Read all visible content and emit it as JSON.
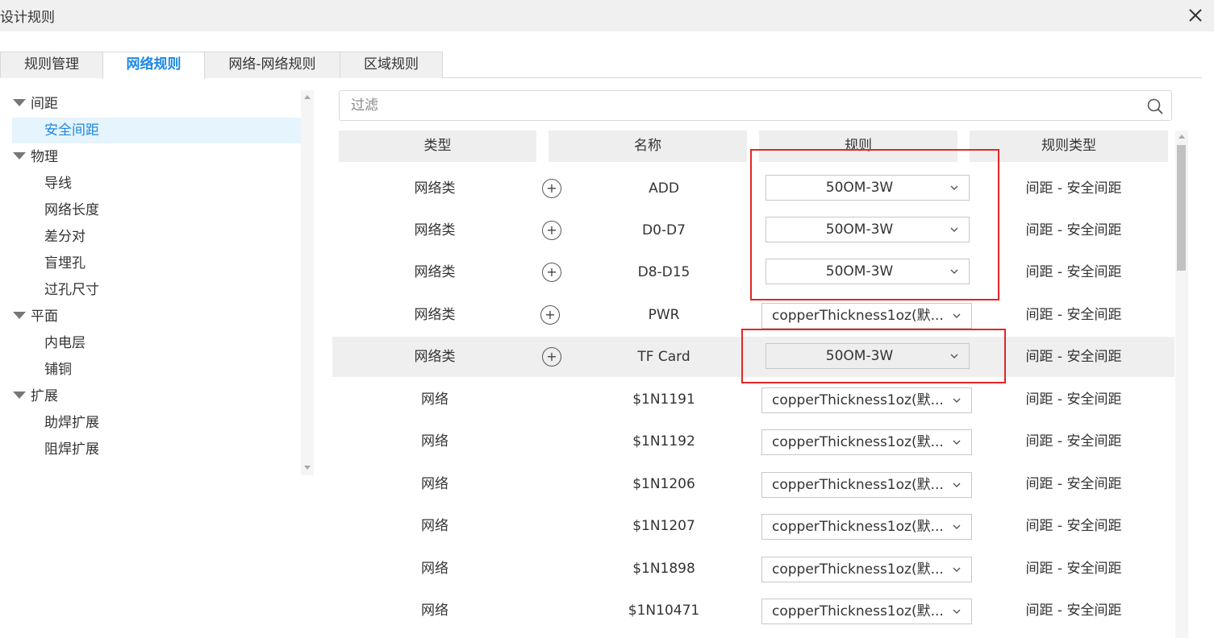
{
  "window": {
    "title": "设计规则"
  },
  "tabs": [
    {
      "label": "规则管理",
      "active": false
    },
    {
      "label": "网络规则",
      "active": true
    },
    {
      "label": "网络-网络规则",
      "active": false
    },
    {
      "label": "区域规则",
      "active": false
    }
  ],
  "tree": {
    "spacing": {
      "label": "间距",
      "children": [
        "安全间距"
      ]
    },
    "physical": {
      "label": "物理",
      "children": [
        "导线",
        "网络长度",
        "差分对",
        "盲埋孔",
        "过孔尺寸"
      ]
    },
    "plane": {
      "label": "平面",
      "children": [
        "内电层",
        "铺铜"
      ]
    },
    "expansion": {
      "label": "扩展",
      "children": [
        "助焊扩展",
        "阻焊扩展"
      ]
    },
    "selected": "安全间距"
  },
  "filter": {
    "placeholder": "过滤",
    "value": ""
  },
  "table": {
    "headers": {
      "type": "类型",
      "name": "名称",
      "rule": "规则",
      "rule_type": "规则类型"
    },
    "plus_symbol": "+",
    "rows": [
      {
        "type": "网络类",
        "name": "ADD",
        "rule": "50OM-3W",
        "rule_type": "间距 - 安全间距"
      },
      {
        "type": "网络类",
        "name": "D0-D7",
        "rule": "50OM-3W",
        "rule_type": "间距 - 安全间距"
      },
      {
        "type": "网络类",
        "name": "D8-D15",
        "rule": "50OM-3W",
        "rule_type": "间距 - 安全间距"
      },
      {
        "type": "网络类",
        "name": "PWR",
        "rule": "copperThickness1oz(默...",
        "rule_type": "间距 - 安全间距"
      },
      {
        "type": "网络类",
        "name": "TF Card",
        "rule": "50OM-3W",
        "rule_type": "间距 - 安全间距",
        "highlighted": true
      },
      {
        "type": "网络",
        "name": "$1N1191",
        "rule": "copperThickness1oz(默...",
        "rule_type": "间距 - 安全间距"
      },
      {
        "type": "网络",
        "name": "$1N1192",
        "rule": "copperThickness1oz(默...",
        "rule_type": "间距 - 安全间距"
      },
      {
        "type": "网络",
        "name": "$1N1206",
        "rule": "copperThickness1oz(默...",
        "rule_type": "间距 - 安全间距"
      },
      {
        "type": "网络",
        "name": "$1N1207",
        "rule": "copperThickness1oz(默...",
        "rule_type": "间距 - 安全间距"
      },
      {
        "type": "网络",
        "name": "$1N1898",
        "rule": "copperThickness1oz(默...",
        "rule_type": "间距 - 安全间距"
      },
      {
        "type": "网络",
        "name": "$1N10471",
        "rule": "copperThickness1oz(默...",
        "rule_type": "间距 - 安全间距"
      }
    ]
  },
  "colors": {
    "accent": "#1e88e5",
    "annotation_red": "#e32626",
    "selected_bg": "#e6f4fd"
  }
}
